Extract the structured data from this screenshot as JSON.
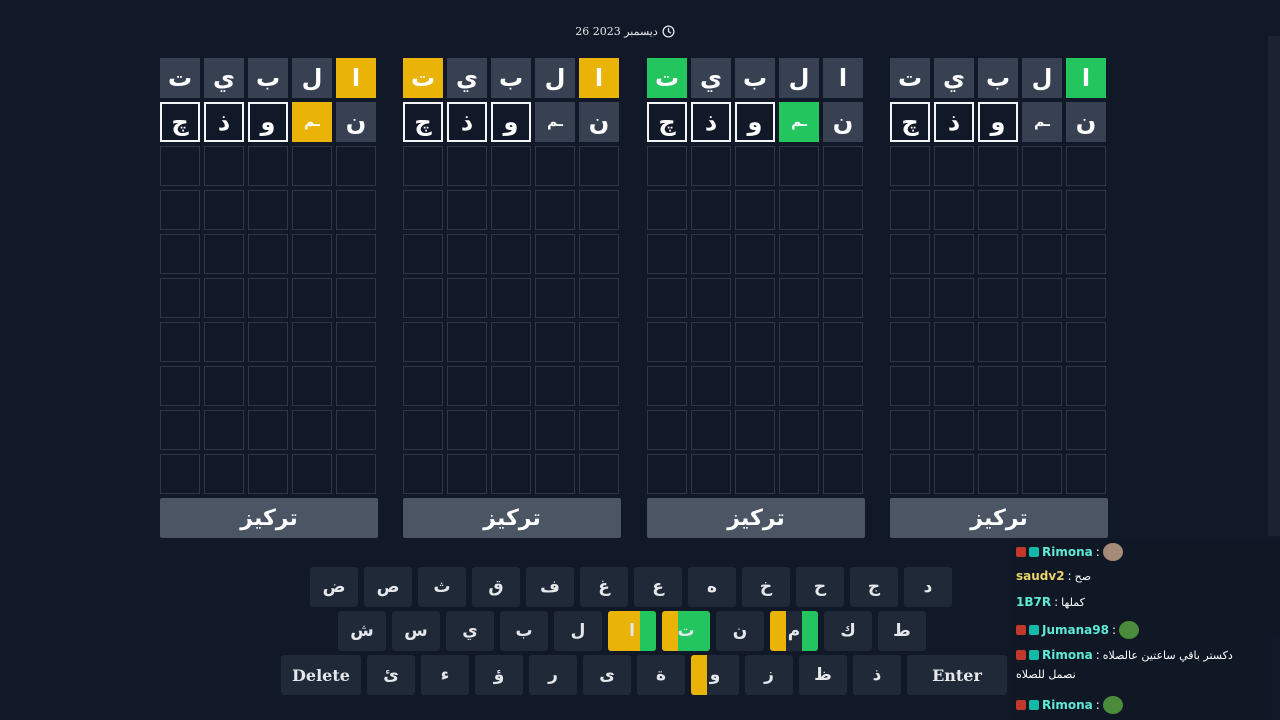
{
  "header": {
    "date": "26 ديسمبر 2023",
    "clock_icon": "clock-icon"
  },
  "boards": [
    {
      "rows": [
        [
          {
            "l": "ت",
            "s": "filled"
          },
          {
            "l": "ي",
            "s": "filled"
          },
          {
            "l": "ب",
            "s": "filled"
          },
          {
            "l": "ل",
            "s": "filled"
          },
          {
            "l": "ا",
            "s": "yellow"
          }
        ],
        [
          {
            "l": "چ",
            "s": "input"
          },
          {
            "l": "ذ",
            "s": "input"
          },
          {
            "l": "و",
            "s": "input"
          },
          {
            "l": "ـم",
            "s": "yellow"
          },
          {
            "l": "ن",
            "s": "filled"
          }
        ]
      ],
      "focus": "تركيز"
    },
    {
      "rows": [
        [
          {
            "l": "ت",
            "s": "yellow"
          },
          {
            "l": "ي",
            "s": "filled"
          },
          {
            "l": "ب",
            "s": "filled"
          },
          {
            "l": "ل",
            "s": "filled"
          },
          {
            "l": "ا",
            "s": "yellow"
          }
        ],
        [
          {
            "l": "چ",
            "s": "input"
          },
          {
            "l": "ذ",
            "s": "input"
          },
          {
            "l": "و",
            "s": "input"
          },
          {
            "l": "ـم",
            "s": "filled"
          },
          {
            "l": "ن",
            "s": "filled"
          }
        ]
      ],
      "focus": "تركيز"
    },
    {
      "rows": [
        [
          {
            "l": "ت",
            "s": "green"
          },
          {
            "l": "ي",
            "s": "filled"
          },
          {
            "l": "ب",
            "s": "filled"
          },
          {
            "l": "ل",
            "s": "filled"
          },
          {
            "l": "ا",
            "s": "filled"
          }
        ],
        [
          {
            "l": "چ",
            "s": "input"
          },
          {
            "l": "ذ",
            "s": "input"
          },
          {
            "l": "و",
            "s": "input"
          },
          {
            "l": "ـم",
            "s": "green"
          },
          {
            "l": "ن",
            "s": "filled"
          }
        ]
      ],
      "focus": "تركيز"
    },
    {
      "rows": [
        [
          {
            "l": "ت",
            "s": "filled"
          },
          {
            "l": "ي",
            "s": "filled"
          },
          {
            "l": "ب",
            "s": "filled"
          },
          {
            "l": "ل",
            "s": "filled"
          },
          {
            "l": "ا",
            "s": "green"
          }
        ],
        [
          {
            "l": "چ",
            "s": "input"
          },
          {
            "l": "ذ",
            "s": "input"
          },
          {
            "l": "و",
            "s": "input"
          },
          {
            "l": "ـم",
            "s": "filled"
          },
          {
            "l": "ن",
            "s": "filled"
          }
        ]
      ],
      "focus": "تركيز"
    }
  ],
  "keyboard": {
    "row1": [
      {
        "k": "ض"
      },
      {
        "k": "ص"
      },
      {
        "k": "ث"
      },
      {
        "k": "ق"
      },
      {
        "k": "ف"
      },
      {
        "k": "غ"
      },
      {
        "k": "ع"
      },
      {
        "k": "ه"
      },
      {
        "k": "خ"
      },
      {
        "k": "ح"
      },
      {
        "k": "ج"
      },
      {
        "k": "د"
      }
    ],
    "row2": [
      {
        "k": "ش"
      },
      {
        "k": "س"
      },
      {
        "k": "ي"
      },
      {
        "k": "ب"
      },
      {
        "k": "ل"
      },
      {
        "k": "ا",
        "marks": [
          "yellow",
          "yellow",
          "green"
        ]
      },
      {
        "k": "ت",
        "marks": [
          "yellow",
          "green",
          "green"
        ]
      },
      {
        "k": "ن"
      },
      {
        "k": "م",
        "marks": [
          "yellow",
          "none",
          "green"
        ]
      },
      {
        "k": "ك"
      },
      {
        "k": "ط"
      }
    ],
    "row3": [
      {
        "k": "Delete",
        "wide": 1
      },
      {
        "k": "ئ"
      },
      {
        "k": "ء"
      },
      {
        "k": "ؤ"
      },
      {
        "k": "ر"
      },
      {
        "k": "ى"
      },
      {
        "k": "ة"
      },
      {
        "k": "و",
        "marks": [
          "yellow",
          "none",
          "none"
        ]
      },
      {
        "k": "ز"
      },
      {
        "k": "ظ"
      },
      {
        "k": "ذ"
      },
      {
        "k": "Enter",
        "wide": 2
      }
    ]
  },
  "chat": [
    {
      "user": "Rimona",
      "text": "",
      "emote": true,
      "badges": 2,
      "color": "#5eead4"
    },
    {
      "user": "saudv2",
      "text": "صح",
      "badges": 0,
      "color": "#e9d26a"
    },
    {
      "user": "1B7R",
      "text": "كملها",
      "badges": 0,
      "color": "#5eead4"
    },
    {
      "user": "Jumana98",
      "text": "",
      "emote": true,
      "badges": 2,
      "color": "#5eead4"
    },
    {
      "user": "Rimona",
      "text": "دكستر باقي ساعتين عالصلاه",
      "badges": 2,
      "color": "#5eead4"
    },
    {
      "user": "",
      "text": "نصمل للصلاه",
      "badges": 0,
      "color": "#fff"
    },
    {
      "user": "Rimona",
      "text": "",
      "emote": true,
      "badges": 2,
      "color": "#5eead4"
    }
  ],
  "colors": {
    "yellow": "#eab308",
    "green": "#22c55e",
    "bg": "#111827",
    "tile": "#374151",
    "key": "#1f2937"
  }
}
